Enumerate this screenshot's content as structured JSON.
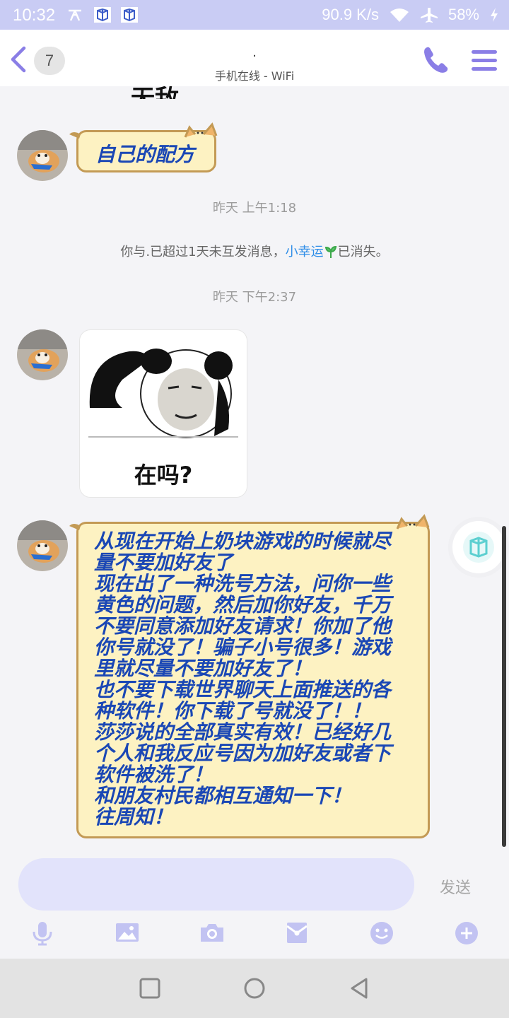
{
  "status_bar": {
    "time": "10:32",
    "network_speed": "90.9 K/s",
    "battery": "58%"
  },
  "header": {
    "unread_count": "7",
    "contact_name": ".",
    "online_status": "手机在线 - WiFi"
  },
  "messages": {
    "partial_text_top": "无敌",
    "bubble1": "自己的配方",
    "time1": "昨天 上午1:18",
    "system_prefix": "你与.已超过1天未互发消息，",
    "system_link": "小幸运",
    "system_suffix": "已消失。",
    "time2": "昨天 下午2:37",
    "sticker_caption": "在吗?",
    "long_message_lines": [
      "从现在开始上奶块游戏的时候就尽",
      "量不要加好友了",
      "现在出了一种洗号方法，问你一些",
      "黄色的问题，然后加你好友，千万",
      "不要同意添加好友请求！你加了他",
      "你号就没了！骗子小号很多！游戏",
      "里就尽量不要加好友了！",
      "也不要下载世界聊天上面推送的各",
      "种软件！你下载了号就没了！！",
      "莎莎说的全部真实有效！已经好几",
      "个人和我反应号因为加好友或者下",
      "软件被洗了！",
      "和朋友村民都相互通知一下！",
      "往周知！"
    ]
  },
  "input_bar": {
    "send_label": "发送",
    "placeholder": ""
  },
  "colors": {
    "accent": "#8a7ee6",
    "bubble_bg": "#fdf2c2",
    "bubble_text": "#1a47b5",
    "link": "#2f8ee8"
  },
  "icons": [
    "back-icon",
    "phone-icon",
    "menu-icon",
    "mic-icon",
    "image-icon",
    "camera-icon",
    "red-packet-icon",
    "emoji-icon",
    "plus-icon",
    "square-nav-icon",
    "circle-nav-icon",
    "back-nav-icon"
  ]
}
